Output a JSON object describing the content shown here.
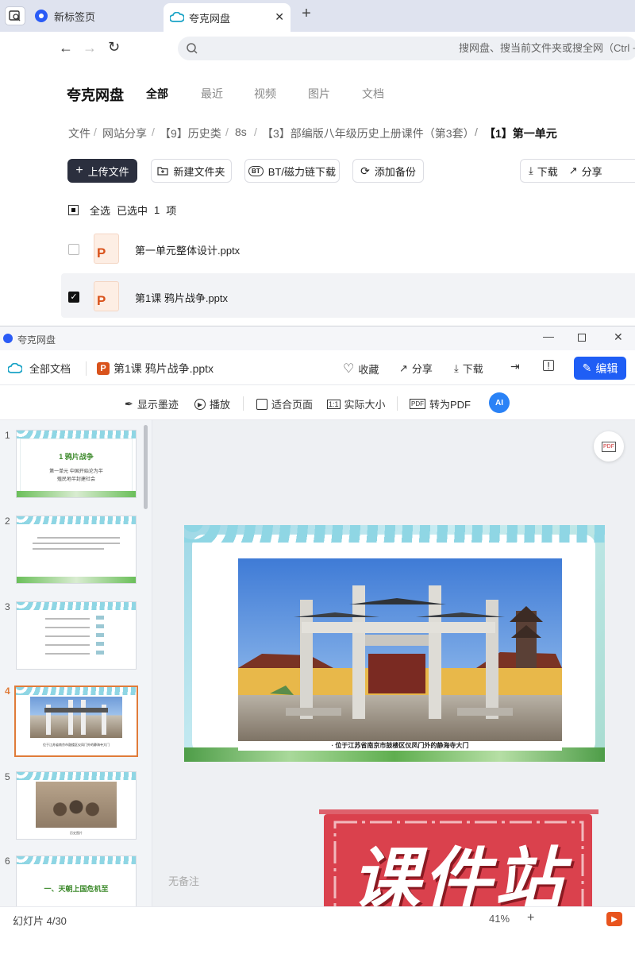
{
  "browser": {
    "tabs": [
      {
        "label": "新标签页"
      },
      {
        "label": "夸克网盘"
      }
    ],
    "new_tab_symbol": "+",
    "address_placeholder": "搜网盘、搜当前文件夹或搜全网（Ctrl + K）"
  },
  "drive": {
    "logo": "夸克网盘",
    "nav": [
      "全部",
      "最近",
      "视频",
      "图片",
      "文档"
    ],
    "breadcrumb": [
      "文件",
      "网站分享",
      "【9】历史类",
      "8s",
      "【3】部编版八年级历史上册课件（第3套）",
      "【1】第一单元"
    ],
    "breadcrumb_sep": "/",
    "buttons": {
      "upload": "上传文件",
      "new_folder": "新建文件夹",
      "bt": "BT/磁力链下载",
      "backup": "添加备份",
      "download": "下载",
      "share": "分享"
    },
    "selection": {
      "select_all": "全选",
      "selected_prefix": "已选中",
      "count": "1",
      "suffix": "项"
    },
    "files": [
      {
        "name": "第一单元整体设计.pptx",
        "checked": false
      },
      {
        "name": "第1课 鸦片战争.pptx",
        "checked": true
      }
    ]
  },
  "viewer": {
    "window_title": "夸克网盘",
    "all_docs": "全部文档",
    "file_name": "第1课 鸦片战争.pptx",
    "actions": {
      "favorite": "收藏",
      "share": "分享",
      "download": "下载",
      "edit": "编辑"
    },
    "tools": {
      "ink": "显示墨迹",
      "play": "播放",
      "fit": "适合页面",
      "actual": "实际大小",
      "pdf": "转为PDF",
      "ai": "AI"
    },
    "slides": [
      {
        "num": "1",
        "title": "1  鸦片战争",
        "sub1": "第一单元  中国开始沦为半",
        "sub2": "殖民地半封建社会"
      },
      {
        "num": "2",
        "text": "通过了解鸦片战争的背景和过程..."
      },
      {
        "num": "3",
        "text": "鸦片战争目录"
      },
      {
        "num": "4",
        "caption": "位于江苏省南京市鼓楼区仪凤门外的静海寺大门"
      },
      {
        "num": "5",
        "caption": "历史图片"
      },
      {
        "num": "6",
        "title": "一、天朝上国危机至"
      }
    ],
    "current_slide_caption": "· 位于江苏省南京市鼓楼区仪凤门外的静海寺大门",
    "notes_placeholder": "无备注",
    "status": "幻灯片 4/30",
    "zoom": "41%",
    "watermark": "课件站"
  },
  "colors": {
    "accent": "#1f5ef5",
    "upload_btn": "#2b2f3e",
    "selected_slide_border": "#e07b39",
    "watermark_red": "#d8323f",
    "ppt_orange": "#d9531c"
  }
}
